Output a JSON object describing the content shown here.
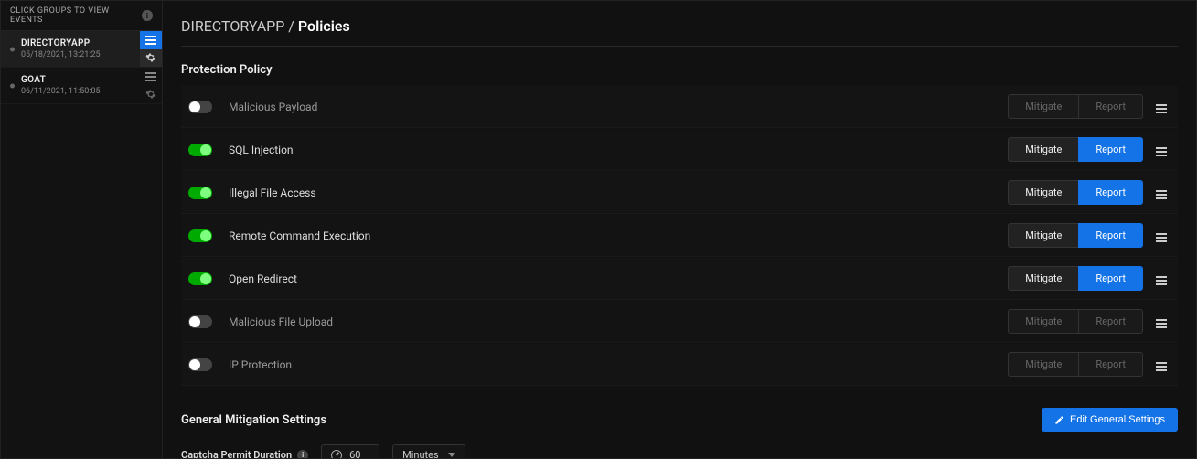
{
  "sidebar": {
    "header": "CLICK GROUPS TO VIEW EVENTS",
    "groups": [
      {
        "name": "DIRECTORYAPP",
        "date": "05/18/2021, 13:21:25",
        "selected": true
      },
      {
        "name": "GOAT",
        "date": "06/11/2021, 11:50:05",
        "selected": false
      }
    ]
  },
  "breadcrumb": {
    "root": "DIRECTORYAPP",
    "sep": " / ",
    "current": "Policies"
  },
  "sections": {
    "protection_title": "Protection Policy",
    "general_title": "General Mitigation Settings"
  },
  "buttons": {
    "mitigate": "Mitigate",
    "report": "Report",
    "edit_general": "Edit General Settings"
  },
  "policies": [
    {
      "label": "Malicious Payload",
      "enabled": false
    },
    {
      "label": "SQL Injection",
      "enabled": true
    },
    {
      "label": "Illegal File Access",
      "enabled": true
    },
    {
      "label": "Remote Command Execution",
      "enabled": true
    },
    {
      "label": "Open Redirect",
      "enabled": true
    },
    {
      "label": "Malicious File Upload",
      "enabled": false
    },
    {
      "label": "IP Protection",
      "enabled": false
    }
  ],
  "captcha": {
    "label": "Captcha Permit Duration",
    "value": "60",
    "unit": "Minutes"
  }
}
